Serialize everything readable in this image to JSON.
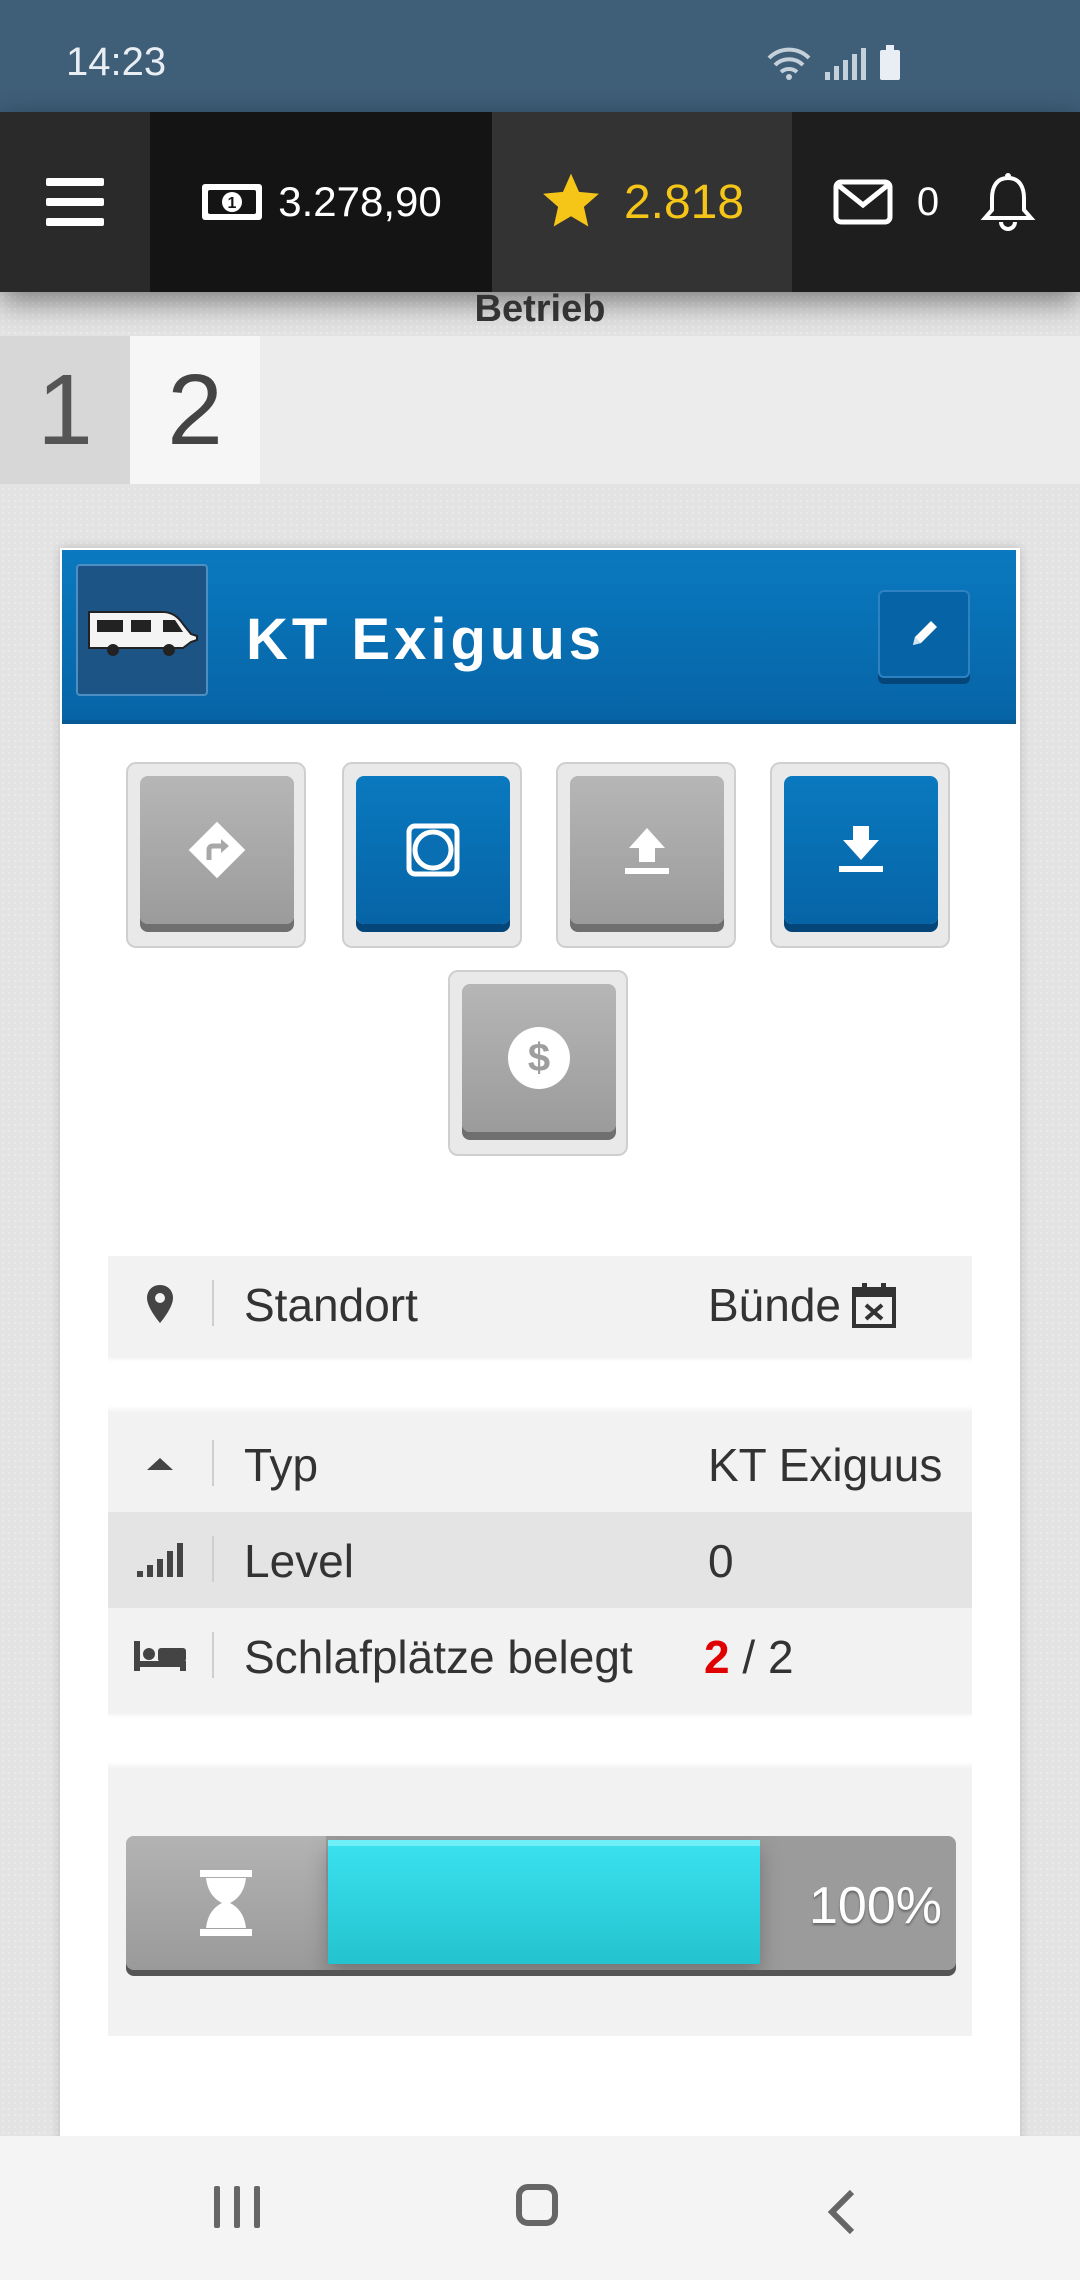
{
  "status_bar": {
    "time": "14:23",
    "icons": [
      "wifi-icon",
      "signal-icon",
      "battery-icon"
    ]
  },
  "topnav": {
    "menu_icon": "hamburger-icon",
    "money": {
      "icon": "banknote-icon",
      "value": "3.278,90"
    },
    "stars": {
      "icon": "star-icon",
      "value": "2.818"
    },
    "mail": {
      "icon": "envelope-icon",
      "value": "0"
    },
    "bell": {
      "icon": "bell-icon"
    }
  },
  "section_title": "Betrieb",
  "tabs": [
    {
      "label": "1"
    },
    {
      "label": "2"
    }
  ],
  "card": {
    "title": "KT Exiguus",
    "thumbnail_icon": "camper-van-icon",
    "edit_icon": "pencil-icon"
  },
  "actions": [
    {
      "name": "route",
      "icon": "route-arrow-icon",
      "style": "gray"
    },
    {
      "name": "ring",
      "icon": "ring-icon",
      "style": "blue"
    },
    {
      "name": "upload",
      "icon": "upload-icon",
      "style": "gray"
    },
    {
      "name": "download",
      "icon": "download-icon",
      "style": "blue"
    },
    {
      "name": "money",
      "icon": "dollar-icon",
      "style": "gray"
    }
  ],
  "info": {
    "standort": {
      "icon": "location-pin-icon",
      "label": "Standort",
      "value": "Bünde",
      "value_icon": "calendar-x-icon"
    },
    "typ": {
      "icon": "caret-up-icon",
      "label": "Typ",
      "value": "KT Exiguus"
    },
    "level": {
      "icon": "level-bars-icon",
      "label": "Level",
      "value": "0"
    },
    "schlafplaetze": {
      "icon": "bed-icon",
      "label": "Schlafplätze belegt",
      "occupied": "2",
      "separator": " / ",
      "total": "2"
    }
  },
  "progress": {
    "icon": "hourglass-icon",
    "percent": 100,
    "label": "100%"
  },
  "colors": {
    "header_blue": "#0664a6",
    "progress_cyan": "#2ed3df",
    "star_yellow": "#f5c518",
    "link_blue": "#1573ad",
    "alert_red": "#e00000"
  }
}
